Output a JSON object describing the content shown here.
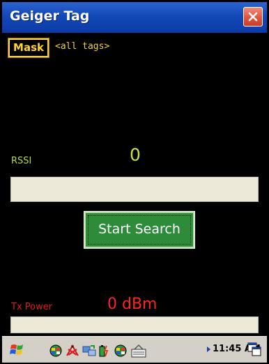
{
  "window": {
    "title": "Geiger Tag"
  },
  "mask": {
    "button_label": "Mask",
    "value": "<all tags>"
  },
  "rssi": {
    "label": "RSSI",
    "value": "0"
  },
  "search": {
    "button_label": "Start Search"
  },
  "tx_power": {
    "label": "Tx Power",
    "value": "0 dBm"
  },
  "taskbar": {
    "time": "11:45 AM",
    "tray_icons": [
      "network-icon",
      "wireless-icon",
      "sync-icon",
      "battery-icon",
      "network-icon-2",
      "keyboard-icon"
    ]
  },
  "colors": {
    "title_bar": "#1348b8",
    "rssi_text": "#c3e33f",
    "tx_power_text": "#ff2323",
    "mask_text": "#ffd430",
    "search_button": "#2e8b3a"
  }
}
